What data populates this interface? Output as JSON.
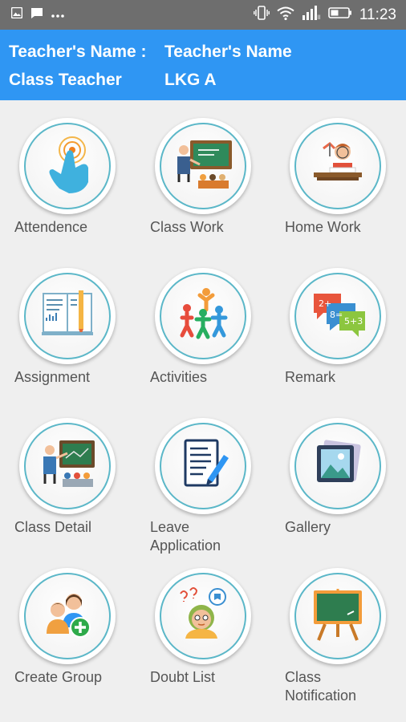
{
  "status_bar": {
    "time": "11:23",
    "icons": [
      "image-icon",
      "message-icon",
      "more-icon",
      "vibrate-icon",
      "wifi-icon",
      "signal-icon",
      "battery-icon"
    ]
  },
  "header": {
    "teacher_name_label": "Teacher's Name :",
    "teacher_name_value": "Teacher's Name",
    "class_teacher_label": "Class Teacher",
    "class_teacher_value": "LKG A",
    "background_color": "#2f96f3"
  },
  "menu": {
    "items": [
      {
        "label": "Attendence",
        "icon": "touch-hand-icon"
      },
      {
        "label": "Class Work",
        "icon": "classroom-board-icon"
      },
      {
        "label": "Home Work",
        "icon": "student-desk-icon"
      },
      {
        "label": "Assignment",
        "icon": "notebook-pencil-icon"
      },
      {
        "label": "Activities",
        "icon": "people-activity-icon"
      },
      {
        "label": "Remark",
        "icon": "speech-bubbles-icon"
      },
      {
        "label": "Class Detail",
        "icon": "teacher-board-icon"
      },
      {
        "label": "Leave\nApplication",
        "icon": "document-pen-icon"
      },
      {
        "label": "Gallery",
        "icon": "picture-icon"
      },
      {
        "label": "Create Group",
        "icon": "add-group-icon"
      },
      {
        "label": "Doubt List",
        "icon": "student-question-icon"
      },
      {
        "label": "Class\nNotification",
        "icon": "chalkboard-easel-icon"
      }
    ]
  }
}
